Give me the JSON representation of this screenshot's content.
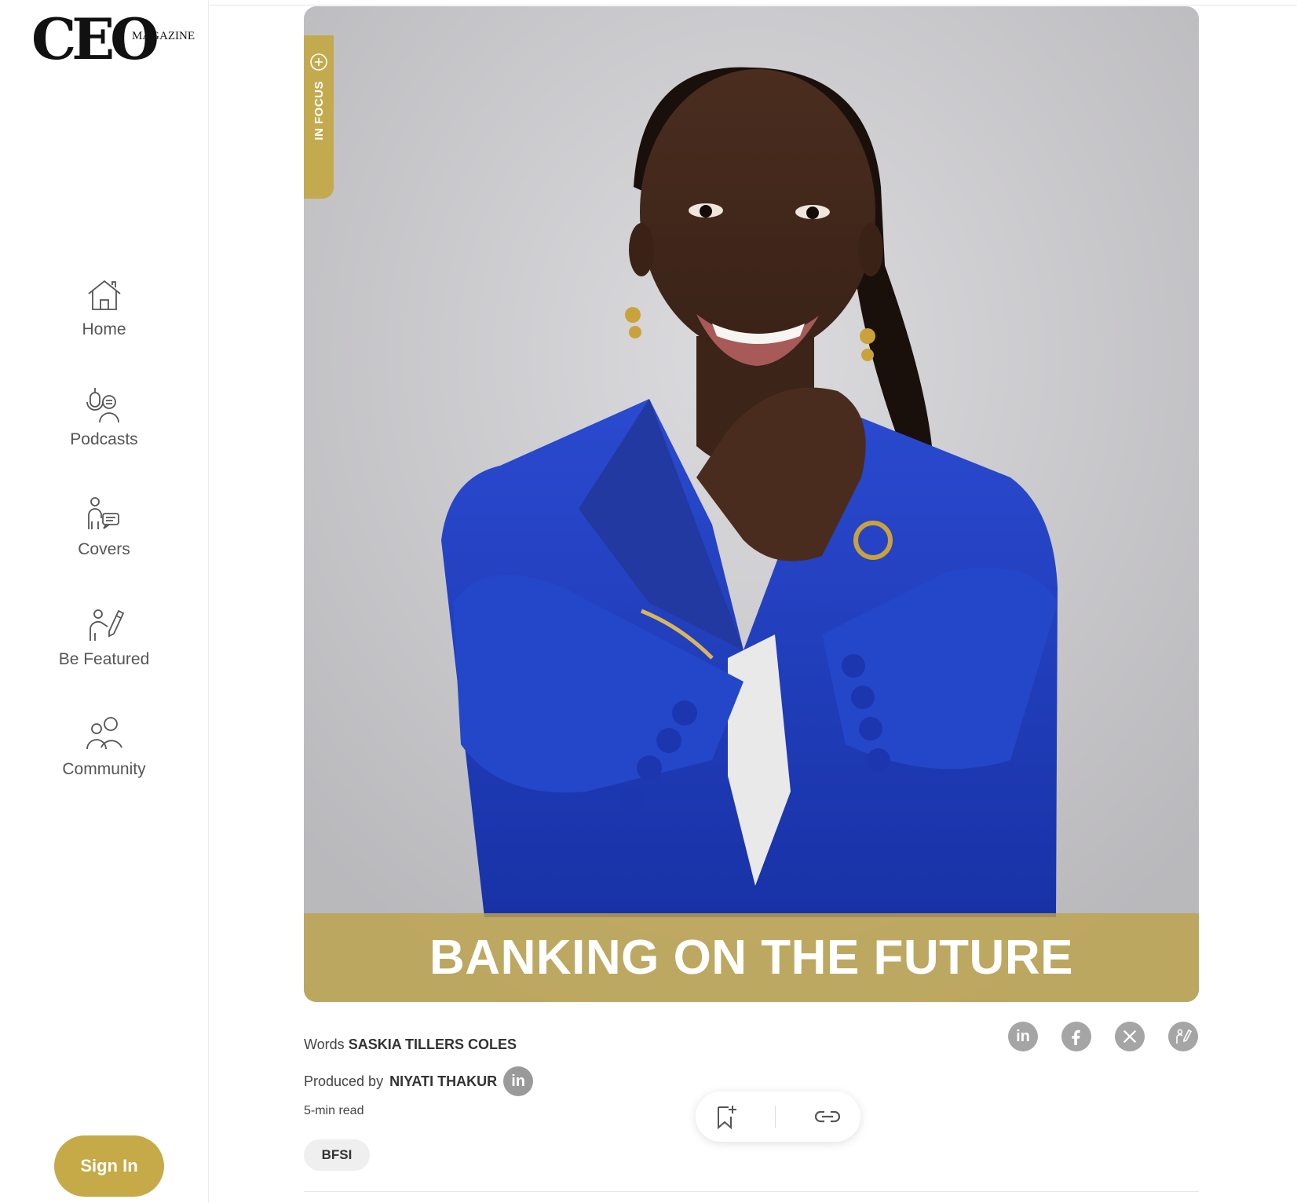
{
  "brand": {
    "logo_main": "CEO",
    "logo_sub": "MAGAZINE"
  },
  "sidebar": {
    "items": [
      {
        "label": "Home",
        "icon": "home-icon"
      },
      {
        "label": "Podcasts",
        "icon": "podcast-icon"
      },
      {
        "label": "Covers",
        "icon": "covers-icon"
      },
      {
        "label": "Be Featured",
        "icon": "be-featured-icon"
      },
      {
        "label": "Community",
        "icon": "community-icon"
      }
    ],
    "signin_label": "Sign In"
  },
  "hero": {
    "badge": "IN FOCUS",
    "title": "BANKING ON THE FUTURE"
  },
  "article": {
    "words_prefix": "Words",
    "author": "SASKIA TILLERS COLES",
    "produced_prefix": "Produced by",
    "producer": "NIYATI THAKUR",
    "producer_social": "in",
    "read_time": "5-min read",
    "tag": "BFSI"
  },
  "share": {
    "icons": [
      "linkedin-icon",
      "facebook-icon",
      "x-icon",
      "be-featured-icon"
    ],
    "linkedin_label": "in"
  },
  "actions": {
    "icons": [
      "bookmark-add-icon",
      "link-icon"
    ]
  },
  "colors": {
    "accent": "#c5aa47",
    "blazer": "#1f3fbf",
    "icon_grey": "#a5a5a5"
  }
}
